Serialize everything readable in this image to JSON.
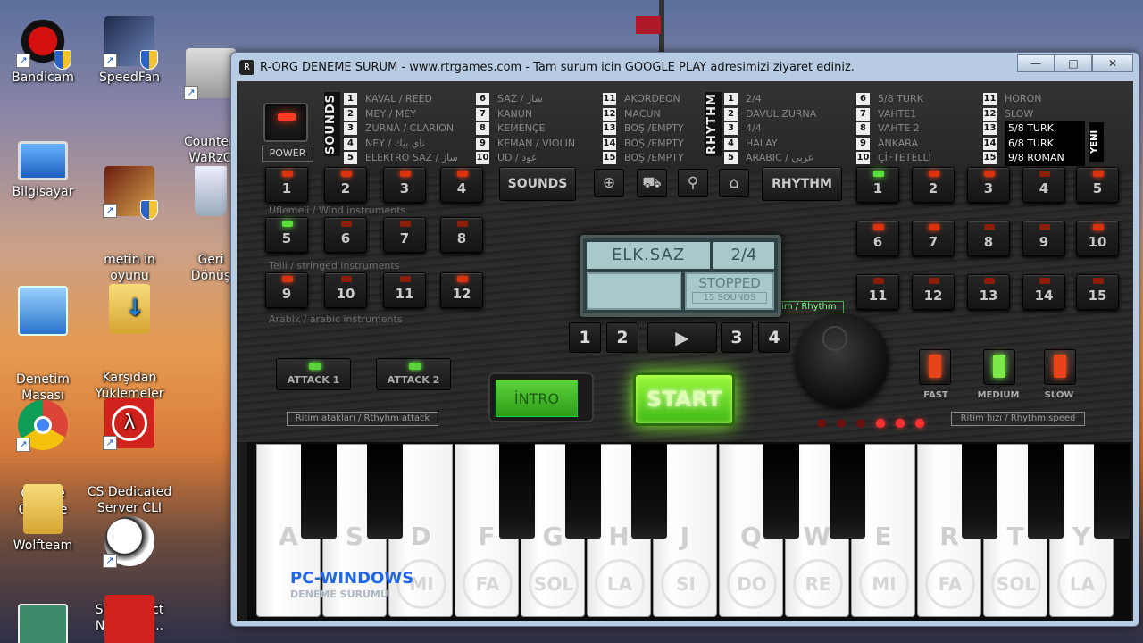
{
  "desktop": {
    "icons": [
      {
        "label": "Bandicam"
      },
      {
        "label": "SpeedFan"
      },
      {
        "label": "Counter-\nWaRzO"
      },
      {
        "label": "Bilgisayar"
      },
      {
        "label": "metin in\noyunu"
      },
      {
        "label": "Geri\nDönüş"
      },
      {
        "label": "Denetim\nMasası"
      },
      {
        "label": "Karşıdan\nYüklemeler"
      },
      {
        "label": "Google\nChrome"
      },
      {
        "label": "CS Dedicated\nServer CLI"
      },
      {
        "label": "Wolfteam"
      },
      {
        "label": "SoftPerfect\nNetwork ..."
      }
    ]
  },
  "window": {
    "title": "R-ORG DENEME SURUM - www.rtrgames.com - Tam surum icin GOOGLE PLAY adresimizi ziyaret ediniz.",
    "min_icon": "minimize-icon",
    "max_icon": "maximize-icon",
    "close_icon": "close-icon",
    "min_glyph": "—",
    "max_glyph": "□",
    "close_glyph": "✕"
  },
  "top": {
    "power_label": "POWER",
    "sounds_vlabel": "SOUNDS",
    "rhythm_vlabel": "RHYTHM",
    "yeni": "YENİ",
    "sounds_col1": [
      {
        "n": "1",
        "t": "KAVAL / REED"
      },
      {
        "n": "2",
        "t": "MEY / MEY"
      },
      {
        "n": "3",
        "t": "ZURNA / CLARION"
      },
      {
        "n": "4",
        "t": "NEY / ناي بيك"
      },
      {
        "n": "5",
        "t": "ELEKTRO SAZ / ساز"
      }
    ],
    "sounds_col2": [
      {
        "n": "6",
        "t": "SAZ / ساز"
      },
      {
        "n": "7",
        "t": "KANUN"
      },
      {
        "n": "8",
        "t": "KEMENÇE"
      },
      {
        "n": "9",
        "t": "KEMAN / VIOLIN"
      },
      {
        "n": "10",
        "t": "UD / عود"
      }
    ],
    "sounds_col3": [
      {
        "n": "11",
        "t": "AKORDEON"
      },
      {
        "n": "12",
        "t": "MACUN"
      },
      {
        "n": "13",
        "t": "BOŞ /EMPTY"
      },
      {
        "n": "14",
        "t": "BOŞ /EMPTY"
      },
      {
        "n": "15",
        "t": "BOŞ /EMPTY"
      }
    ],
    "rhythm_col1": [
      {
        "n": "1",
        "t": "2/4"
      },
      {
        "n": "2",
        "t": "DAVUL ZURNA"
      },
      {
        "n": "3",
        "t": "4/4"
      },
      {
        "n": "4",
        "t": "HALAY"
      },
      {
        "n": "5",
        "t": "ARABIC / عربي"
      }
    ],
    "rhythm_col2": [
      {
        "n": "6",
        "t": "5/8 TURK"
      },
      {
        "n": "7",
        "t": "VAHTE1"
      },
      {
        "n": "8",
        "t": "VAHTE 2"
      },
      {
        "n": "9",
        "t": "ANKARA"
      },
      {
        "n": "10",
        "t": "ÇİFTETELLİ"
      }
    ],
    "rhythm_col3": [
      {
        "n": "11",
        "t": "HORON"
      },
      {
        "n": "12",
        "t": "SLOW"
      },
      {
        "n": "13",
        "t": "5/8 TURK"
      },
      {
        "n": "14",
        "t": "6/8 TURK"
      },
      {
        "n": "15",
        "t": "9/8 ROMAN"
      }
    ]
  },
  "groups": {
    "wind": "Üflemeli / Wind instruments",
    "strings": "Telli / stringed instruments",
    "arabic": "Arabik / arabic instruments",
    "attack_tag": "Ritim atakları / Rthyhm attack",
    "speed_tag": "Ritim hızı / Rhythm speed",
    "ritim_tag": "Ritim / Rhythm"
  },
  "buttons": {
    "sounds": "SOUNDS",
    "rhythm": "RHYTHM",
    "attack1": "ATTACK 1",
    "attack2": "ATTACK 2",
    "intro": "İNTRO",
    "start": "START",
    "play": "▶",
    "fast": "FAST",
    "medium": "MEDIUM",
    "slow": "SLOW",
    "web_icon": "globe-icon",
    "cart_icon": "cart-icon",
    "search_icon": "search-icon",
    "home_icon": "home-icon"
  },
  "sound_pads": [
    "1",
    "2",
    "3",
    "4",
    "5",
    "6",
    "7",
    "8",
    "9",
    "10",
    "11",
    "12"
  ],
  "rhythm_pads": [
    "1",
    "2",
    "3",
    "4",
    "5",
    "6",
    "7",
    "8",
    "9",
    "10",
    "11",
    "12",
    "13",
    "14",
    "15"
  ],
  "patterns": [
    "1",
    "2",
    "3",
    "4"
  ],
  "display": {
    "instrument": "ELK.SAZ",
    "rhythm": "2/4",
    "status": "STOPPED",
    "sounds_count": "15 SOUNDS"
  },
  "keyboard": {
    "white_keys": [
      {
        "key": "A",
        "note": ""
      },
      {
        "key": "S",
        "note": ""
      },
      {
        "key": "D",
        "note": "MI"
      },
      {
        "key": "F",
        "note": "FA"
      },
      {
        "key": "G",
        "note": "SOL"
      },
      {
        "key": "H",
        "note": "LA"
      },
      {
        "key": "J",
        "note": "SI"
      },
      {
        "key": "Q",
        "note": "DO"
      },
      {
        "key": "W",
        "note": "RE"
      },
      {
        "key": "E",
        "note": "MI"
      },
      {
        "key": "R",
        "note": "FA"
      },
      {
        "key": "T",
        "note": "SOL"
      },
      {
        "key": "Y",
        "note": "LA"
      }
    ],
    "watermark": "PC-WINDOWS",
    "watermark_sub": "DENEME SÜRÜMÜ"
  },
  "colors": {
    "led_red": "#d8320e",
    "led_green": "#59e03b",
    "start_green": "#7be22a",
    "display_bg": "#a9c8c9"
  }
}
